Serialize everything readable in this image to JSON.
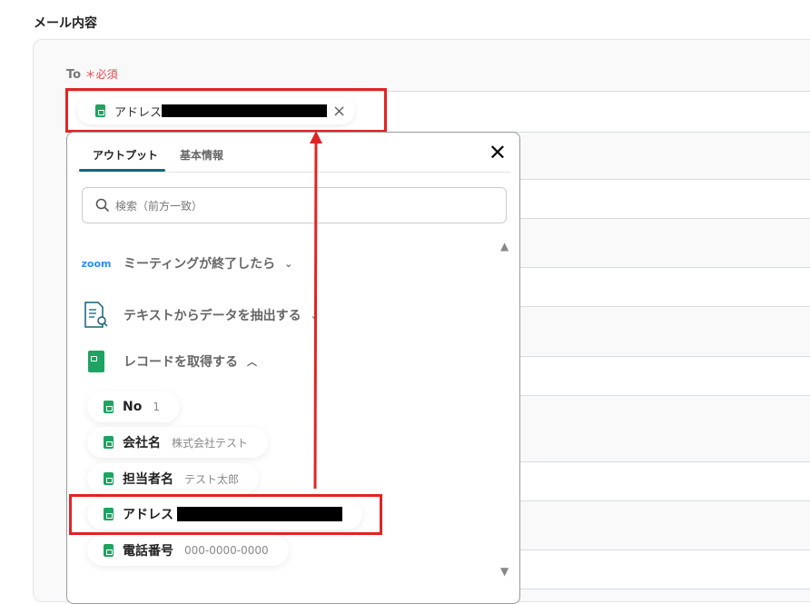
{
  "section_title": "メール内容",
  "to_field": {
    "label": "To",
    "required_mark": "＊必須",
    "chip_label": "アドレス"
  },
  "dropdown": {
    "tabs": [
      "アウトプット",
      "基本情報"
    ],
    "search_placeholder": "検索（前方一致）",
    "groups": [
      {
        "icon": "zoom-logo",
        "logo_text": "zoom",
        "label": "ミーティングが終了したら",
        "state": "collapsed"
      },
      {
        "icon": "document-search-icon",
        "label": "テキストからデータを抽出する",
        "state": "collapsed"
      },
      {
        "icon": "google-sheets-icon",
        "label": "レコードを取得する",
        "state": "expanded"
      }
    ],
    "items": [
      {
        "label": "No",
        "value": "1"
      },
      {
        "label": "会社名",
        "value": "株式会社テスト"
      },
      {
        "label": "担当者名",
        "value": "テスト太郎"
      },
      {
        "label": "アドレス",
        "value": ""
      },
      {
        "label": "電話番号",
        "value": "000-0000-0000"
      }
    ]
  },
  "colors": {
    "accent": "#0f6a7f",
    "annotation": "#e02424",
    "sheets": "#1ea362",
    "required": "#e5484d"
  }
}
